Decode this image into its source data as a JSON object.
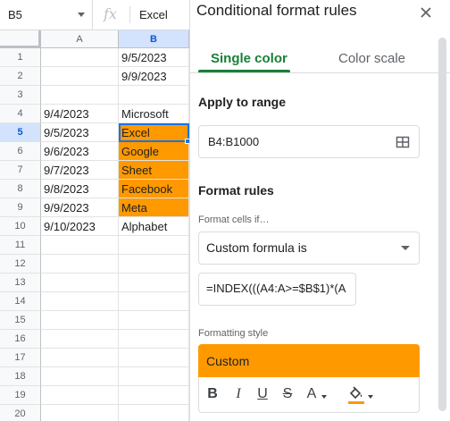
{
  "formula_bar": {
    "name_box": "B5",
    "fx_symbol": "fx",
    "value": "Excel"
  },
  "columns": [
    "A",
    "B"
  ],
  "selected_column": "B",
  "rows": [
    {
      "num": "1",
      "a": "",
      "b": "9/5/2023",
      "highlight": false
    },
    {
      "num": "2",
      "a": "",
      "b": "9/9/2023",
      "highlight": false
    },
    {
      "num": "3",
      "a": "",
      "b": "",
      "highlight": false
    },
    {
      "num": "4",
      "a": "9/4/2023",
      "b": "Microsoft",
      "highlight": false
    },
    {
      "num": "5",
      "a": "9/5/2023",
      "b": "Excel",
      "highlight": true,
      "active": true
    },
    {
      "num": "6",
      "a": "9/6/2023",
      "b": "Google",
      "highlight": true
    },
    {
      "num": "7",
      "a": "9/7/2023",
      "b": "Sheet",
      "highlight": true
    },
    {
      "num": "8",
      "a": "9/8/2023",
      "b": "Facebook",
      "highlight": true
    },
    {
      "num": "9",
      "a": "9/9/2023",
      "b": "Meta",
      "highlight": true
    },
    {
      "num": "10",
      "a": "9/10/2023",
      "b": "Alphabet",
      "highlight": false
    },
    {
      "num": "11",
      "a": "",
      "b": "",
      "highlight": false
    },
    {
      "num": "12",
      "a": "",
      "b": "",
      "highlight": false
    },
    {
      "num": "13",
      "a": "",
      "b": "",
      "highlight": false
    },
    {
      "num": "14",
      "a": "",
      "b": "",
      "highlight": false
    },
    {
      "num": "15",
      "a": "",
      "b": "",
      "highlight": false
    },
    {
      "num": "16",
      "a": "",
      "b": "",
      "highlight": false
    },
    {
      "num": "17",
      "a": "",
      "b": "",
      "highlight": false
    },
    {
      "num": "18",
      "a": "",
      "b": "",
      "highlight": false
    },
    {
      "num": "19",
      "a": "",
      "b": "",
      "highlight": false
    },
    {
      "num": "20",
      "a": "",
      "b": "",
      "highlight": false
    }
  ],
  "panel": {
    "title": "Conditional format rules",
    "close_icon": "close-icon",
    "tabs": [
      {
        "label": "Single color",
        "active": true
      },
      {
        "label": "Color scale",
        "active": false
      }
    ],
    "apply_to_range": {
      "label": "Apply to range",
      "value": "B4:B1000",
      "icon": "grid-select-icon"
    },
    "format_rules": {
      "label": "Format rules",
      "condition_label": "Format cells if…",
      "condition_value": "Custom formula is",
      "formula": "=INDEX(((A4:A>=$B$1)*(A"
    },
    "formatting_style": {
      "label": "Formatting style",
      "preset": "Custom",
      "fill_color": "#ff9900",
      "tools": [
        "B",
        "I",
        "U",
        "S",
        "A"
      ]
    }
  },
  "colors": {
    "highlight": "#ff9900",
    "accent": "#188038",
    "selection": "#1a73e8"
  }
}
